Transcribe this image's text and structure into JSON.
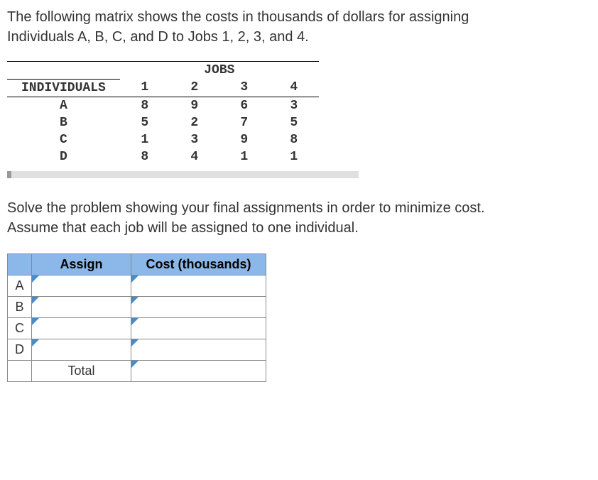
{
  "problem_text_line1": "The following matrix shows the costs in thousands of dollars for assigning",
  "problem_text_line2": "Individuals A, B, C, and D to Jobs 1, 2, 3, and 4.",
  "matrix": {
    "jobs_label": "JOBS",
    "individuals_label": "INDIVIDUALS",
    "job_headers": [
      "1",
      "2",
      "3",
      "4"
    ],
    "rows": [
      {
        "label": "A",
        "values": [
          "8",
          "9",
          "6",
          "3"
        ]
      },
      {
        "label": "B",
        "values": [
          "5",
          "2",
          "7",
          "5"
        ]
      },
      {
        "label": "C",
        "values": [
          "1",
          "3",
          "9",
          "8"
        ]
      },
      {
        "label": "D",
        "values": [
          "8",
          "4",
          "1",
          "1"
        ]
      }
    ]
  },
  "instruction_line1": "Solve the problem showing your final assignments in order to minimize cost.",
  "instruction_line2": "Assume that each job will be assigned to one individual.",
  "answer_table": {
    "assign_header": "Assign",
    "cost_header": "Cost (thousands)",
    "row_labels": [
      "A",
      "B",
      "C",
      "D"
    ],
    "total_label": "Total"
  }
}
